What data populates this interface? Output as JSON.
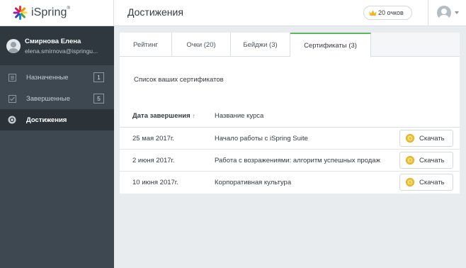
{
  "app": {
    "logo_text": "iSpring",
    "logo_mark": "®"
  },
  "user": {
    "name": "Смирнова Елена",
    "email": "elena.smirnova@ispringu..."
  },
  "sidebar": {
    "items": [
      {
        "label": "Назначенные",
        "count": "1",
        "icon": "assigned-icon"
      },
      {
        "label": "Завершенные",
        "count": "5",
        "icon": "checkbox-icon"
      },
      {
        "label": "Достижения",
        "icon": "achievements-icon"
      }
    ]
  },
  "header": {
    "title": "Достижения",
    "score": "20 очков"
  },
  "tabs": [
    {
      "label": "Рейтинг"
    },
    {
      "label": "Очки (20)"
    },
    {
      "label": "Бейджи (3)"
    },
    {
      "label": "Сертификаты (3)"
    }
  ],
  "main": {
    "subtitle": "Список ваших сертификатов"
  },
  "table": {
    "columns": [
      "Дата завершения",
      "Название курса"
    ],
    "sort_arrow": "↑",
    "rows": [
      {
        "date": "25 мая 2017г.",
        "course": "Начало работы с iSpring Suite",
        "action": "Скачать"
      },
      {
        "date": "2 июня 2017г.",
        "course": "Работа с возражениями: алгоритм успешных продаж",
        "action": "Скачать"
      },
      {
        "date": "10 июня 2017г.",
        "course": "Корпоративная культура",
        "action": "Скачать"
      }
    ]
  },
  "colors": {
    "sidebar": "#3d4850",
    "accent": "#5cb85c",
    "medal": "#f2c230"
  }
}
